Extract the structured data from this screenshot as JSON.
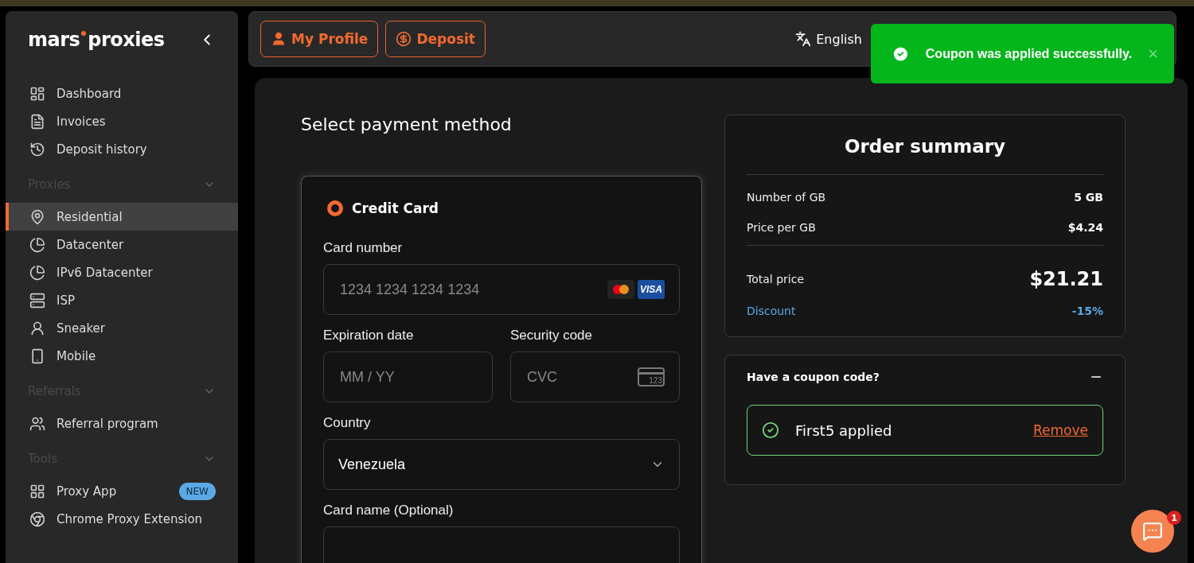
{
  "sidebar": {
    "logo": {
      "first": "mars",
      "second": "proxies"
    },
    "groups": [
      {
        "items": [
          {
            "label": "Dashboard",
            "selected": false
          },
          {
            "label": "Invoices",
            "selected": false
          },
          {
            "label": "Deposit history",
            "selected": false
          }
        ]
      },
      {
        "title": "Proxies",
        "expanded": true,
        "items": [
          {
            "label": "Residential",
            "selected": true
          },
          {
            "label": "Datacenter",
            "selected": false
          },
          {
            "label": "IPv6 Datacenter",
            "selected": false
          },
          {
            "label": "ISP",
            "selected": false
          },
          {
            "label": "Sneaker",
            "selected": false
          },
          {
            "label": "Mobile",
            "selected": false
          }
        ]
      },
      {
        "title": "Referrals",
        "expanded": true,
        "items": [
          {
            "label": "Referral program",
            "selected": false
          }
        ]
      },
      {
        "title": "Tools",
        "expanded": true,
        "items": [
          {
            "label": "Proxy App",
            "selected": false,
            "badge": "NEW"
          },
          {
            "label": "Chrome Proxy Extension",
            "selected": false
          }
        ]
      }
    ]
  },
  "topbar": {
    "buttons": [
      "My Profile",
      "Deposit"
    ],
    "language": "English"
  },
  "toast": {
    "message": "Coupon was applied successfully.",
    "close": "×"
  },
  "payment": {
    "title": "Select payment method",
    "method": {
      "label": "Credit Card",
      "selected": true
    },
    "fields": [
      {
        "label": "Card number",
        "placeholder": "1234 1234 1234 1234",
        "kind": "card"
      },
      {
        "label": "Expiration date",
        "placeholder": "MM / YY",
        "kind": "half"
      },
      {
        "label": "Security code",
        "placeholder": "CVC",
        "kind": "cvc"
      },
      {
        "label": "Country",
        "value": "Venezuela",
        "kind": "select"
      },
      {
        "label": "Card name (Optional)",
        "kind": "text"
      }
    ],
    "cvc_digits": "123",
    "visa": "VISA"
  },
  "summary": {
    "title": "Order summary",
    "rows": [
      {
        "label": "Number of GB",
        "value": "5 GB"
      },
      {
        "label": "Price per GB",
        "value": "$4.24"
      }
    ],
    "total": {
      "label": "Total price",
      "value": "$21.21"
    },
    "discount": {
      "label": "Discount",
      "value": "-15%"
    }
  },
  "coupon": {
    "title": "Have a coupon code?",
    "expanded": true,
    "applied": "First5 applied",
    "remove": "Remove"
  },
  "chat": {
    "badge": "1"
  }
}
